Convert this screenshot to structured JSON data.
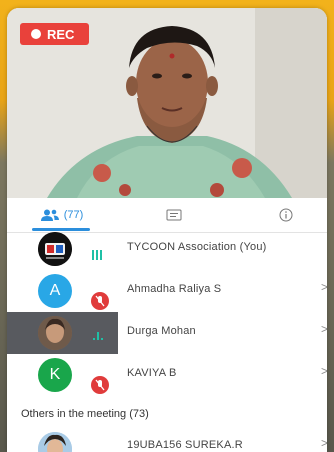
{
  "recording": {
    "label": "REC",
    "color": "#e9413b"
  },
  "tabs": [
    {
      "name": "participants",
      "icon": "people-icon",
      "count_label": "(77)",
      "active": true
    },
    {
      "name": "chat",
      "icon": "chat-icon",
      "active": false
    },
    {
      "name": "info",
      "icon": "info-icon",
      "active": false
    }
  ],
  "participants": [
    {
      "name": "TYCOON Association (You)",
      "avatar": "logo",
      "status": "speaking"
    },
    {
      "name": "Ahmadha Raliya S",
      "avatar_letter": "A",
      "avatar_color": "#29a7e6",
      "status": "muted"
    },
    {
      "name": "Durga Mohan",
      "avatar": "photo",
      "status": "speaking",
      "highlighted": true
    },
    {
      "name": "KAVIYA B",
      "avatar_letter": "K",
      "avatar_color": "#19a64b",
      "status": "muted"
    }
  ],
  "others_section": {
    "label": "Others in the meeting (73)",
    "first": {
      "name": "19UBA156 SUREKA.R",
      "avatar": "photo"
    }
  },
  "colors": {
    "accent": "#2b8edc",
    "mute": "#e03b3b",
    "speaking": "#1fc0a6"
  }
}
